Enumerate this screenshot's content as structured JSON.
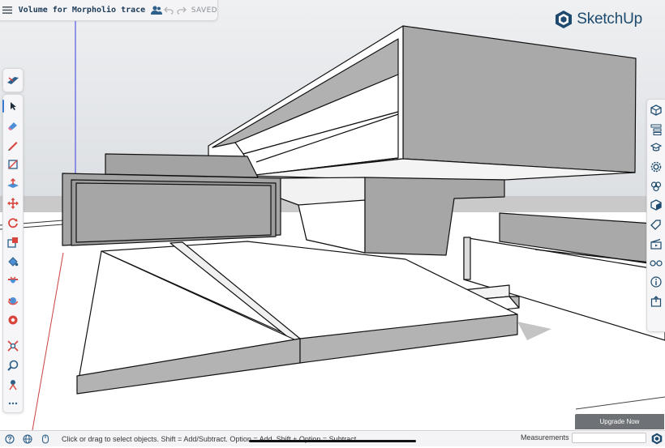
{
  "app": {
    "document_title": "Volume for Morpholio trace",
    "save_status": "SAVED",
    "logo_text": "SketchUp",
    "brand_color": "#1d4a6e",
    "accent_color": "#3b7bd1"
  },
  "title_bar": {
    "menu_icon": "hamburger-menu-icon",
    "collaborators_icon": "people-icon",
    "undo_icon": "undo-icon",
    "redo_icon": "redo-icon"
  },
  "left_toolbar": {
    "top_tool": "section-plane-display-icon",
    "tools": [
      {
        "name": "select",
        "icon": "select-arrow-icon",
        "active": true
      },
      {
        "name": "eraser",
        "icon": "eraser-icon"
      },
      {
        "name": "line",
        "icon": "pencil-icon"
      },
      {
        "name": "rectangle",
        "icon": "rectangle-icon"
      },
      {
        "name": "push-pull",
        "icon": "push-pull-icon"
      },
      {
        "name": "move",
        "icon": "move-icon"
      },
      {
        "name": "rotate",
        "icon": "rotate-icon"
      },
      {
        "name": "scale",
        "icon": "scale-icon"
      },
      {
        "name": "paint-bucket",
        "icon": "paint-bucket-icon"
      },
      {
        "name": "section-plane",
        "icon": "section-plane-icon"
      },
      {
        "name": "orbit",
        "icon": "orbit-icon"
      },
      {
        "name": "tape-measure",
        "icon": "tape-measure-icon"
      },
      {
        "name": "zoom-extents",
        "icon": "zoom-extents-icon"
      },
      {
        "name": "zoom",
        "icon": "zoom-icon"
      },
      {
        "name": "position-camera",
        "icon": "position-camera-icon"
      },
      {
        "name": "more",
        "icon": "more-dots-icon"
      }
    ]
  },
  "right_toolbar": {
    "panels": [
      {
        "name": "entity-info",
        "icon": "cube-info-icon"
      },
      {
        "name": "outliner",
        "icon": "outliner-icon"
      },
      {
        "name": "instructor",
        "icon": "graduation-cap-icon"
      },
      {
        "name": "styles",
        "icon": "styles-gear-icon"
      },
      {
        "name": "components",
        "icon": "components-icon"
      },
      {
        "name": "materials",
        "icon": "cube-materials-icon"
      },
      {
        "name": "tags",
        "icon": "tag-icon"
      },
      {
        "name": "scenes",
        "icon": "scenes-clapper-icon"
      },
      {
        "name": "display",
        "icon": "glasses-icon"
      },
      {
        "name": "model-info",
        "icon": "info-icon"
      },
      {
        "name": "export",
        "icon": "export-icon"
      }
    ]
  },
  "status_bar": {
    "hint": "Click or drag to select objects. Shift = Add/Subtract. Option = Add. Shift + Option = Subtract.",
    "measurements_label": "Measurements",
    "measurements_value": "",
    "help_icon": "sketchup-help-icon"
  },
  "upgrade": {
    "label": "Upgrade Now"
  },
  "viewport": {
    "sky_color": "#dfe2e6",
    "ground_color": "#ffffff",
    "face_color": "#a8a8a8",
    "edge_color": "#111111"
  }
}
